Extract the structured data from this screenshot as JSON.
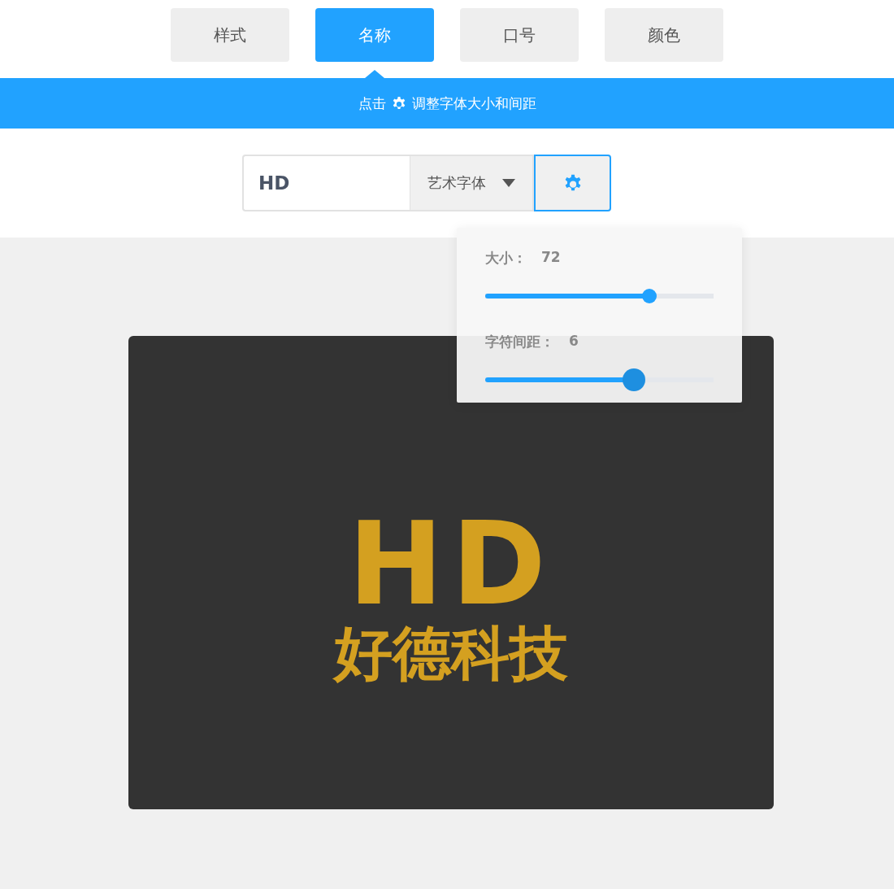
{
  "tabs": [
    {
      "label": "样式",
      "selected": false
    },
    {
      "label": "名称",
      "selected": true
    },
    {
      "label": "口号",
      "selected": false
    },
    {
      "label": "颜色",
      "selected": false
    }
  ],
  "banner": {
    "before": "点击",
    "after": "调整字体大小和间距"
  },
  "toolbar": {
    "name_value": "HD",
    "font": "艺术字体",
    "settings_open": true
  },
  "popover": {
    "sliders": [
      {
        "label": "大小：",
        "reading": "72",
        "level": 0.72,
        "active": false
      },
      {
        "label": "字符间距：",
        "reading": "6",
        "level": 0.65,
        "active": true
      }
    ]
  },
  "preview": {
    "title": "HD",
    "subtitle": "好德科技"
  }
}
